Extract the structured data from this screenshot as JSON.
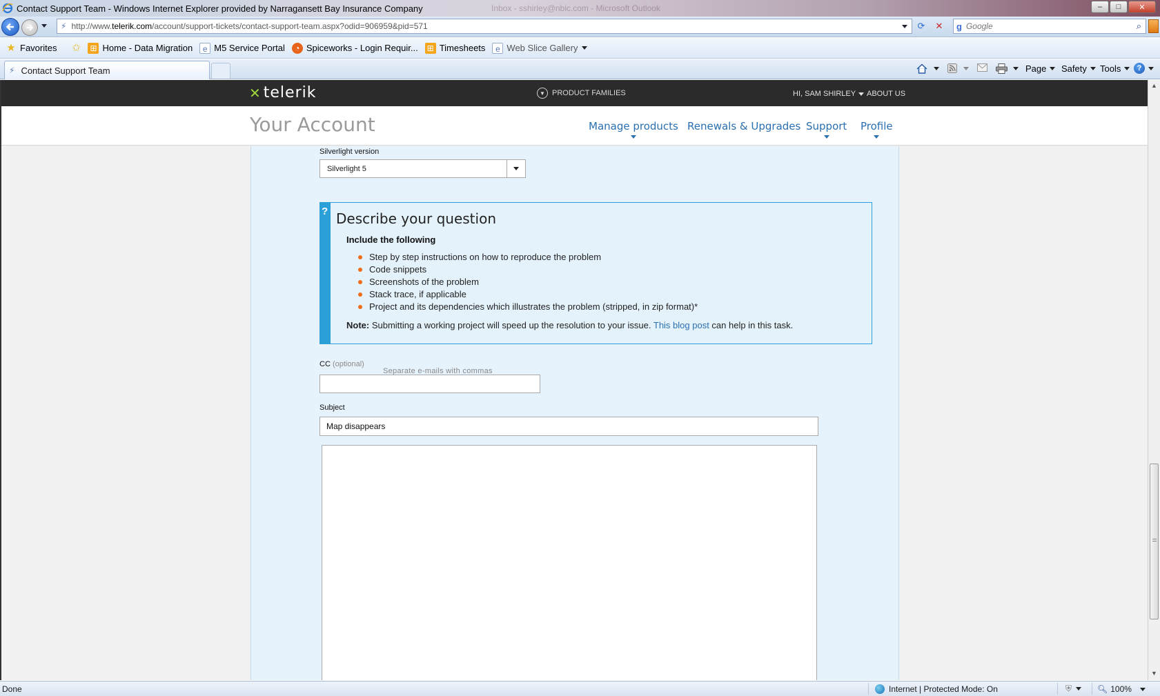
{
  "window": {
    "title": "Contact Support Team - Windows Internet Explorer provided by Narragansett Bay Insurance Company",
    "background_window_title": "Inbox - sshirley@nbic.com - Microsoft Outlook",
    "controls": {
      "minimize": "–",
      "maximize": "□",
      "close": "✕"
    }
  },
  "address_bar": {
    "url_prefix": "http://www.",
    "url_host": "telerik.com",
    "url_path": "/account/support-tickets/contact-support-team.aspx?odid=906959&pid=571",
    "refresh": "⟳",
    "stop": "✕"
  },
  "search": {
    "provider": "g",
    "placeholder": "Google",
    "icon": "search-icon"
  },
  "favorites_bar": {
    "favorites_label": "Favorites",
    "items": [
      {
        "label": "Home - Data Migration",
        "icon": "sharepoint-icon",
        "color": "#f4a51c"
      },
      {
        "label": "M5 Service Portal",
        "icon": "ie-page-icon",
        "color": "#5a7ab0"
      },
      {
        "label": "Spiceworks - Login Requir...",
        "icon": "spiceworks-icon",
        "color": "#e8641b"
      },
      {
        "label": "Timesheets",
        "icon": "sharepoint-icon",
        "color": "#f4a51c"
      },
      {
        "label": "Web Slice Gallery",
        "icon": "ie-page-icon",
        "color": "#5a7ab0"
      }
    ]
  },
  "tabs": {
    "active_tab": "Contact Support Team"
  },
  "command_bar": {
    "page": "Page",
    "safety": "Safety",
    "tools": "Tools",
    "help": "?"
  },
  "site": {
    "logo": "telerik",
    "product_families": "PRODUCT FAMILIES",
    "user_greeting": "HI, SAM SHIRLEY",
    "about": "ABOUT US",
    "account_title": "Your Account",
    "nav": [
      {
        "label": "Manage products",
        "has_submenu": true
      },
      {
        "label": "Renewals & Upgrades",
        "has_submenu": false
      },
      {
        "label": "Support",
        "has_submenu": true
      },
      {
        "label": "Profile",
        "has_submenu": true
      }
    ]
  },
  "form": {
    "silverlight_label": "Silverlight version",
    "silverlight_value": "Silverlight 5",
    "question_box": {
      "icon": "?",
      "title": "Describe your question",
      "subtitle": "Include the following",
      "items": [
        "Step by step instructions on how to reproduce the problem",
        "Code snippets",
        "Screenshots of the problem",
        "Stack trace, if applicable",
        "Project and its dependencies which illustrates the problem (stripped, in zip format)*"
      ],
      "note_label": "Note:",
      "note_text": " Submitting a working project will speed up the resolution to your issue. ",
      "note_link": "This blog post",
      "note_tail": " can help in this task."
    },
    "cc_label": "CC",
    "cc_optional": "(optional)",
    "cc_hint": "Separate e-mails with commas",
    "cc_value": "",
    "subject_label": "Subject",
    "subject_value": "Map disappears",
    "body_value": ""
  },
  "status_bar": {
    "status": "Done",
    "zone": "Internet | Protected Mode: On",
    "zoom": "100%"
  }
}
